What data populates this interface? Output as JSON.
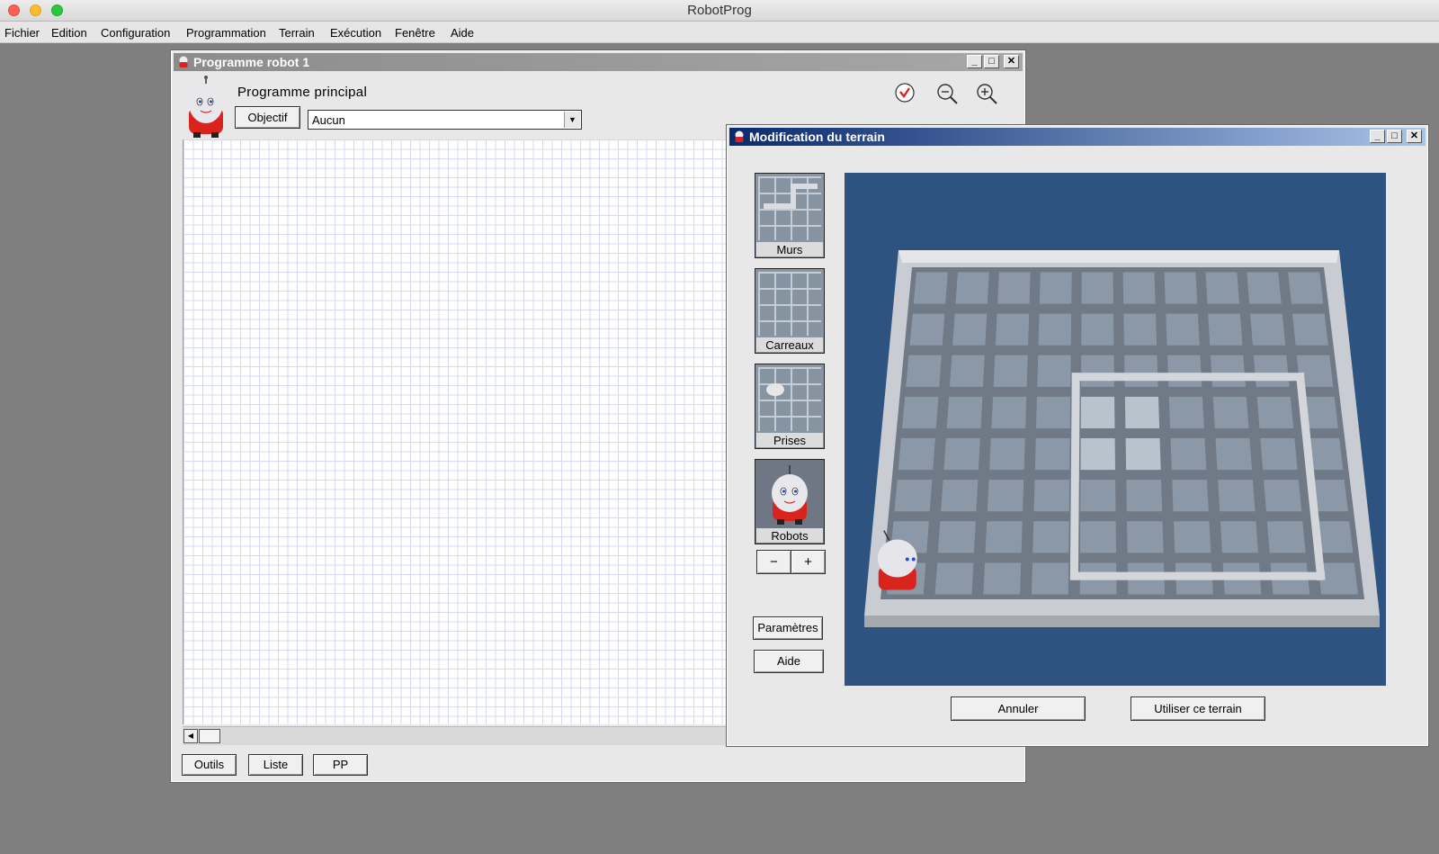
{
  "app": {
    "title": "RobotProg"
  },
  "menu": [
    "Fichier",
    "Edition",
    "Configuration",
    "Programmation",
    "Terrain",
    "Exécution",
    "Fenêtre",
    "Aide"
  ],
  "program_window": {
    "title": "Programme robot 1",
    "heading": "Programme principal",
    "objective_button": "Objectif",
    "objective_select": "Aucun",
    "bottom_buttons": [
      "Outils",
      "Liste",
      "PP"
    ]
  },
  "terrain_window": {
    "title": "Modification du terrain",
    "tools": [
      "Murs",
      "Carreaux",
      "Prises",
      "Robots"
    ],
    "stepper": {
      "minus": "−",
      "plus": "+"
    },
    "params_button": "Paramètres",
    "help_button": "Aide",
    "cancel_button": "Annuler",
    "use_button": "Utiliser ce terrain"
  },
  "colors": {
    "desktop": "#7f7f7f",
    "terrain_bg": "#2f5381",
    "tile": "#8a98a8",
    "wall": "#d3d7dc",
    "robot_red": "#d8241d"
  }
}
